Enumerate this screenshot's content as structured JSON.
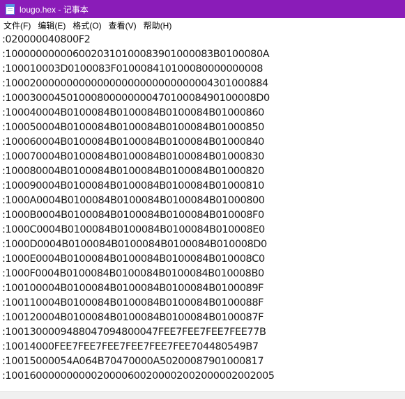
{
  "window": {
    "title": "lougo.hex - 记事本",
    "titlebar_color": "#8a1cb8"
  },
  "menu": {
    "items": [
      "文件(F)",
      "编辑(E)",
      "格式(O)",
      "查看(V)",
      "帮助(H)"
    ]
  },
  "editor": {
    "lines": [
      ":020000040800F2",
      ":1000000000060020310100083901000083B0100080A",
      ":100010003D0100083F010008410100080000000008",
      ":1000200000000000000000000000000004301000884",
      ":10003000450100080000000047010008490100008D0",
      ":100040004B0100084B0100084B0100084B01000860",
      ":100050004B0100084B0100084B0100084B01000850",
      ":100060004B0100084B0100084B0100084B01000840",
      ":100070004B0100084B0100084B0100084B01000830",
      ":100080004B0100084B0100084B0100084B01000820",
      ":100090004B0100084B0100084B0100084B01000810",
      ":1000A0004B0100084B0100084B0100084B01000800",
      ":1000B0004B0100084B0100084B0100084B010008F0",
      ":1000C0004B0100084B0100084B0100084B010008E0",
      ":1000D0004B0100084B0100084B0100084B010008D0",
      ":1000E0004B0100084B0100084B0100084B010008C0",
      ":1000F0004B0100084B0100084B0100084B010008B0",
      ":100100004B0100084B0100084B0100084B0100089F",
      ":100110004B0100084B0100084B0100084B0100088F",
      ":100120004B0100084B0100084B0100084B0100087F",
      ":1001300009488047094800047FEE7FEE7FEE7FEE77B",
      ":10014000FEE7FEE7FEE7FEE7FEE7FEE704480549B7",
      ":10015000054A064B70470000A50200087901000817",
      ":10016000000000020000600200002002000002002005"
    ]
  }
}
